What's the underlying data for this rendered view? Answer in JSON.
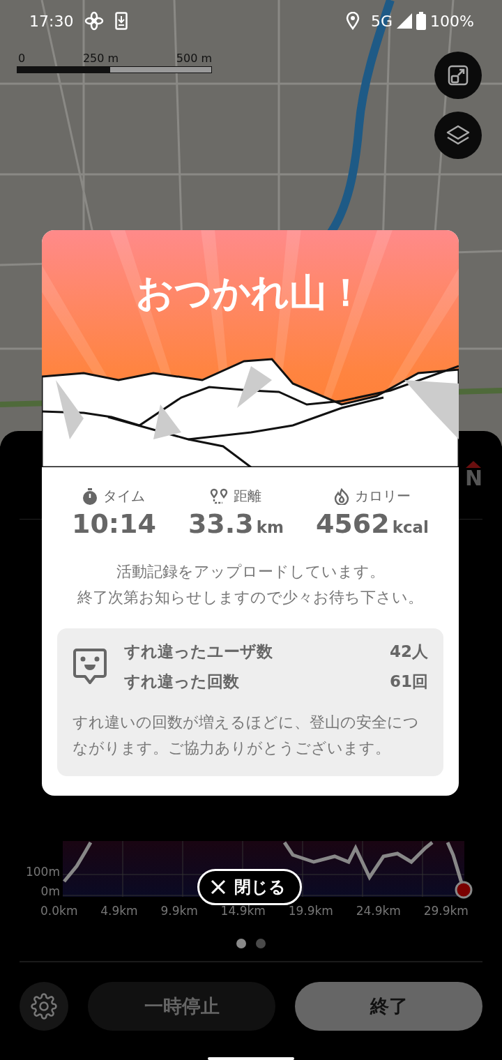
{
  "status_bar": {
    "time": "17:30",
    "network": "5G",
    "battery": "100%"
  },
  "map": {
    "scale_labels": [
      "0",
      "250 m",
      "500 m"
    ]
  },
  "panel": {
    "compass": "N",
    "chart_y_labels": [
      "100m",
      "0m"
    ],
    "chart_x_labels": [
      "0.0km",
      "4.9km",
      "9.9km",
      "14.9km",
      "19.9km",
      "24.9km",
      "29.9km"
    ],
    "pages": [
      {
        "selected": true
      },
      {
        "selected": false
      }
    ],
    "pause_label": "一時停止",
    "finish_label": "終了"
  },
  "dialog": {
    "title": "おつかれ山！",
    "stats": [
      {
        "kind": "time",
        "label": "タイム",
        "value": "10:14"
      },
      {
        "kind": "distance",
        "label": "距離",
        "value": "33.3",
        "unit": "km"
      },
      {
        "kind": "calories",
        "label": "カロリー",
        "value": "4562",
        "unit": "kcal"
      }
    ],
    "messages": [
      "活動記録をアップロードしています。",
      "終了次第お知らせしますので少々お待ち下さい。"
    ],
    "encounters": [
      {
        "label": "すれ違ったユーザ数",
        "value": "42人"
      },
      {
        "label": "すれ違った回数",
        "value": "61回"
      }
    ],
    "encounter_note": "すれ違いの回数が増えるほどに、登山の安全につながります。ご協力ありがとうございます。",
    "close_label": "閉じる"
  }
}
